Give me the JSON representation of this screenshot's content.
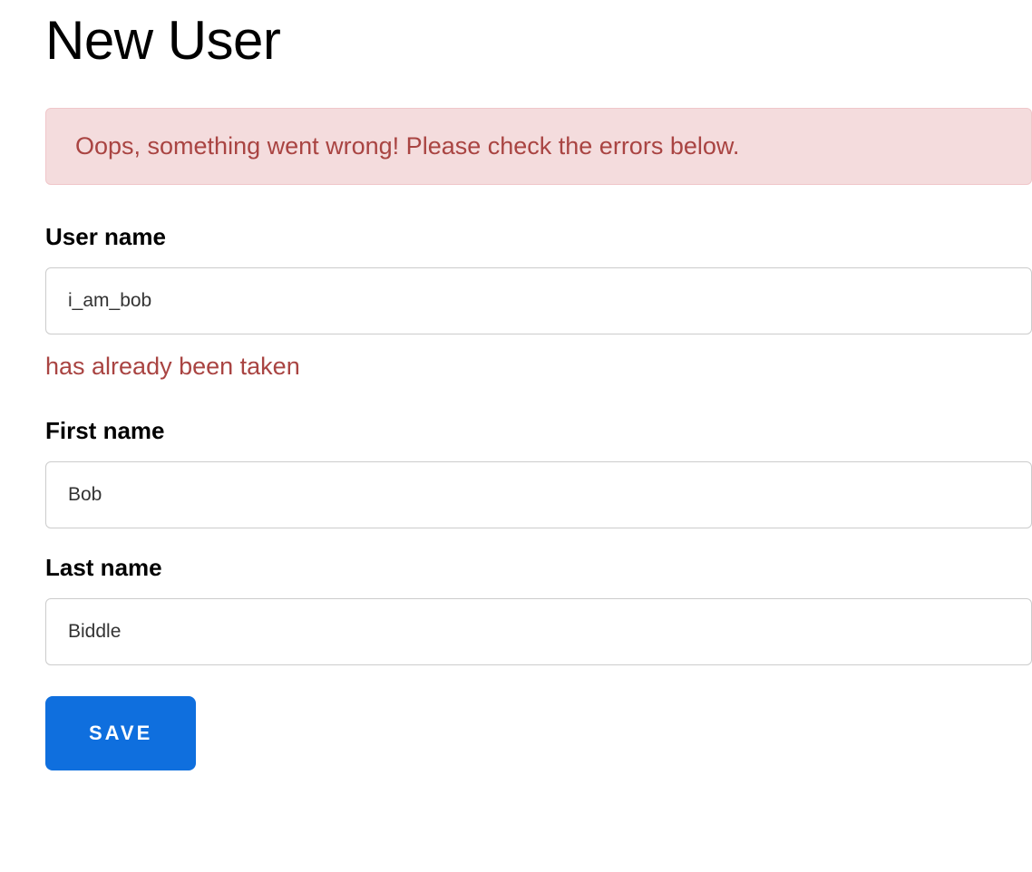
{
  "page": {
    "title": "New User"
  },
  "error_banner": {
    "message": "Oops, something went wrong! Please check the errors below."
  },
  "form": {
    "username": {
      "label": "User name",
      "value": "i_am_bob",
      "error": "has already been taken"
    },
    "first_name": {
      "label": "First name",
      "value": "Bob"
    },
    "last_name": {
      "label": "Last name",
      "value": "Biddle"
    },
    "save_button_label": "SAVE"
  }
}
